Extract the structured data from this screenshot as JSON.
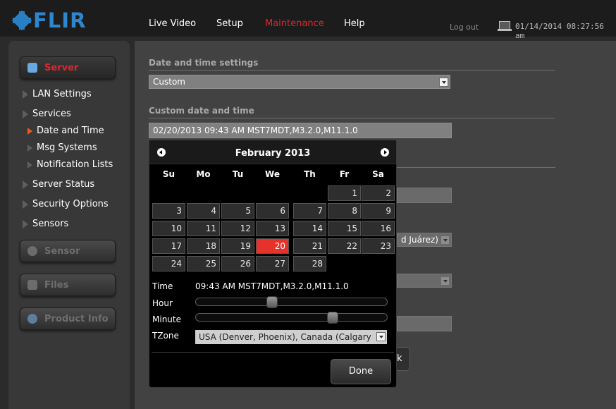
{
  "brand": "FLIR",
  "nav": {
    "live_video": "Live Video",
    "setup": "Setup",
    "maintenance": "Maintenance",
    "help": "Help"
  },
  "header": {
    "logout": "Log out",
    "datetime": "01/14/2014 08:27:56 am"
  },
  "colors": {
    "accent_red": "#e0262c",
    "brand_blue": "#2e86cf",
    "selected_day": "#e5322a"
  },
  "sidebar": {
    "server": "Server",
    "items": {
      "lan": "LAN Settings",
      "services": "Services",
      "date_time": "Date and Time",
      "msg_systems": "Msg Systems",
      "notification_lists": "Notification Lists",
      "server_status": "Server Status",
      "security_options": "Security Options",
      "sensors": "Sensors"
    },
    "sensor": "Sensor",
    "files": "Files",
    "product_info": "Product Info"
  },
  "main": {
    "dt_settings_title": "Date and time settings",
    "dt_settings_value": "Custom",
    "custom_title": "Custom date and time",
    "custom_value": "02/20/2013 09:43 AM MST7MDT,M3.2.0,M11.1.0",
    "tz_partial": "d Juárez)",
    "back_partial": "k"
  },
  "picker": {
    "month": "February 2013",
    "dow": [
      "Su",
      "Mo",
      "Tu",
      "We",
      "Th",
      "Fr",
      "Sa"
    ],
    "weeks": [
      [
        "",
        "",
        "",
        "",
        "",
        "1",
        "2"
      ],
      [
        "3",
        "4",
        "5",
        "6",
        "7",
        "8",
        "9"
      ],
      [
        "10",
        "11",
        "12",
        "13",
        "14",
        "15",
        "16"
      ],
      [
        "17",
        "18",
        "19",
        "20",
        "21",
        "22",
        "23"
      ],
      [
        "24",
        "25",
        "26",
        "27",
        "28",
        "",
        ""
      ]
    ],
    "selected_day": "20",
    "time_label": "Time",
    "time_value": "09:43 AM MST7MDT,M3.2.0,M11.1.0",
    "hour_label": "Hour",
    "hour": 9,
    "minute_label": "Minute",
    "minute": 43,
    "tzone_label": "TZone",
    "tzone_value": "USA (Denver, Phoenix), Canada (Calgary",
    "done": "Done"
  }
}
